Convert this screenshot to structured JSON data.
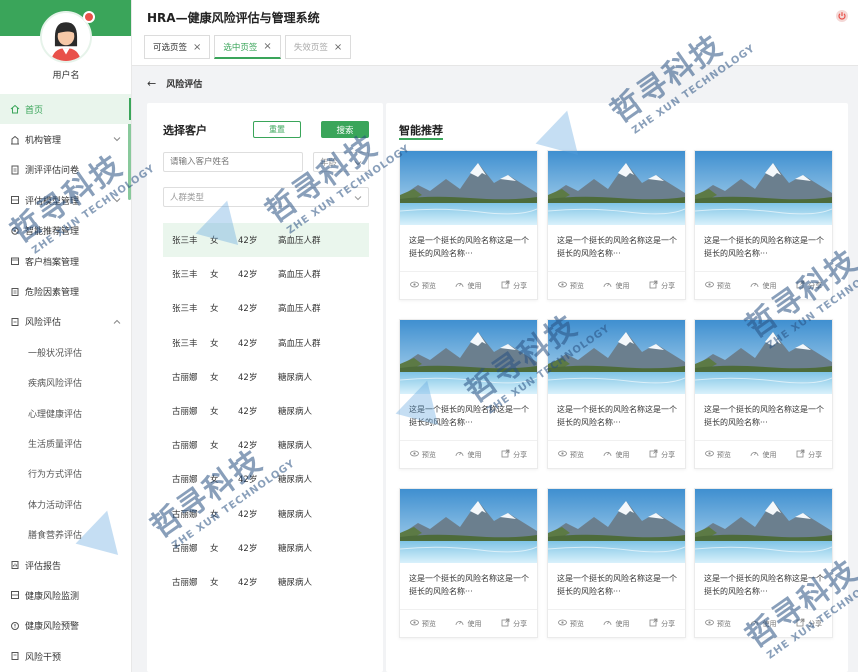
{
  "app": {
    "title": "HRA—健康风险评估与管理系统"
  },
  "user": {
    "name": "用户名"
  },
  "tabs": [
    {
      "label": "可选页签"
    },
    {
      "label": "选中页签"
    },
    {
      "label": "失效页签"
    }
  ],
  "menu": {
    "home": "首页",
    "org": "机构管理",
    "questionnaire": "测评评估问卷",
    "model": "评估模型管理",
    "recommend": "智能推荐管理",
    "archive": "客户档案管理",
    "risk_factor": "危险因素管理",
    "risk_eval": "风险评估",
    "sub": [
      "一般状况评估",
      "疾病风险评估",
      "心理健康评估",
      "生活质量评估",
      "行为方式评估",
      "体力活动评估",
      "膳食营养评估"
    ],
    "report": "评估报告",
    "monitor": "健康风险监测",
    "warning": "健康风险预警",
    "intervene": "风险干预"
  },
  "breadcrumb": {
    "current": "风险评估"
  },
  "customer_panel": {
    "title": "选择客户",
    "reset_label": "重置",
    "search_label": "搜索",
    "name_placeholder": "请输入客户姓名",
    "age_placeholder": "年龄",
    "group_placeholder": "人群类型",
    "rows": [
      {
        "name": "张三丰",
        "gender": "女",
        "age": "42岁",
        "group": "高血压人群"
      },
      {
        "name": "张三丰",
        "gender": "女",
        "age": "42岁",
        "group": "高血压人群"
      },
      {
        "name": "张三丰",
        "gender": "女",
        "age": "42岁",
        "group": "高血压人群"
      },
      {
        "name": "张三丰",
        "gender": "女",
        "age": "42岁",
        "group": "高血压人群"
      },
      {
        "name": "古丽娜",
        "gender": "女",
        "age": "42岁",
        "group": "糖尿病人"
      },
      {
        "name": "古丽娜",
        "gender": "女",
        "age": "42岁",
        "group": "糖尿病人"
      },
      {
        "name": "古丽娜",
        "gender": "女",
        "age": "42岁",
        "group": "糖尿病人"
      },
      {
        "name": "古丽娜",
        "gender": "女",
        "age": "42岁",
        "group": "糖尿病人"
      },
      {
        "name": "古丽娜",
        "gender": "女",
        "age": "42岁",
        "group": "糖尿病人"
      },
      {
        "name": "古丽娜",
        "gender": "女",
        "age": "42岁",
        "group": "糖尿病人"
      },
      {
        "name": "古丽娜",
        "gender": "女",
        "age": "42岁",
        "group": "糖尿病人"
      }
    ]
  },
  "recommend_panel": {
    "title": "智能推荐",
    "card_desc": "这是一个挺长的风险名称这是一个挺长的风险名称···",
    "actions": {
      "preview": "预览",
      "use": "使用",
      "share": "分享"
    }
  },
  "watermark": {
    "cn": "哲寻科技",
    "en": "ZHE XUN TECHNOLOGY"
  },
  "colors": {
    "accent": "#3aa55a",
    "danger": "#e8514a"
  }
}
